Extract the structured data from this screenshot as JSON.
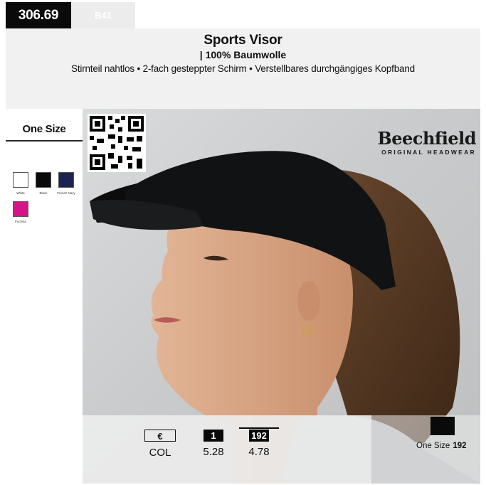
{
  "header": {
    "article_number": "306.69",
    "model_code": "B41",
    "title": "Sports Visor",
    "subtitle": "| 100% Baumwolle",
    "features": "Stirnteil nahtlos • 2-fach gesteppter Schirm • Verstellbares durchgängiges Kopfband"
  },
  "sizes": {
    "label": "One Size"
  },
  "colors": [
    {
      "name": "White",
      "hex": "#ffffff"
    },
    {
      "name": "Black",
      "hex": "#0a0a0a"
    },
    {
      "name": "French Navy",
      "hex": "#1b2350"
    },
    {
      "name": "Fuchsia",
      "hex": "#d6148a"
    }
  ],
  "brand": {
    "name": "Beechfield",
    "tagline": "ORIGINAL HEADWEAR"
  },
  "pricing": {
    "currency": "€",
    "row_label": "COL",
    "tiers": [
      {
        "qty": "1",
        "price": "5.28"
      },
      {
        "qty": "192",
        "price": "4.78"
      }
    ]
  },
  "packaging": {
    "label": "One Size",
    "qty": "192",
    "color_hex": "#0a0a0a"
  },
  "accent_colors": {
    "header_bg": "#f1f1f1",
    "code_bg": "#0a0a0a",
    "panel_bg": "#ececec"
  }
}
